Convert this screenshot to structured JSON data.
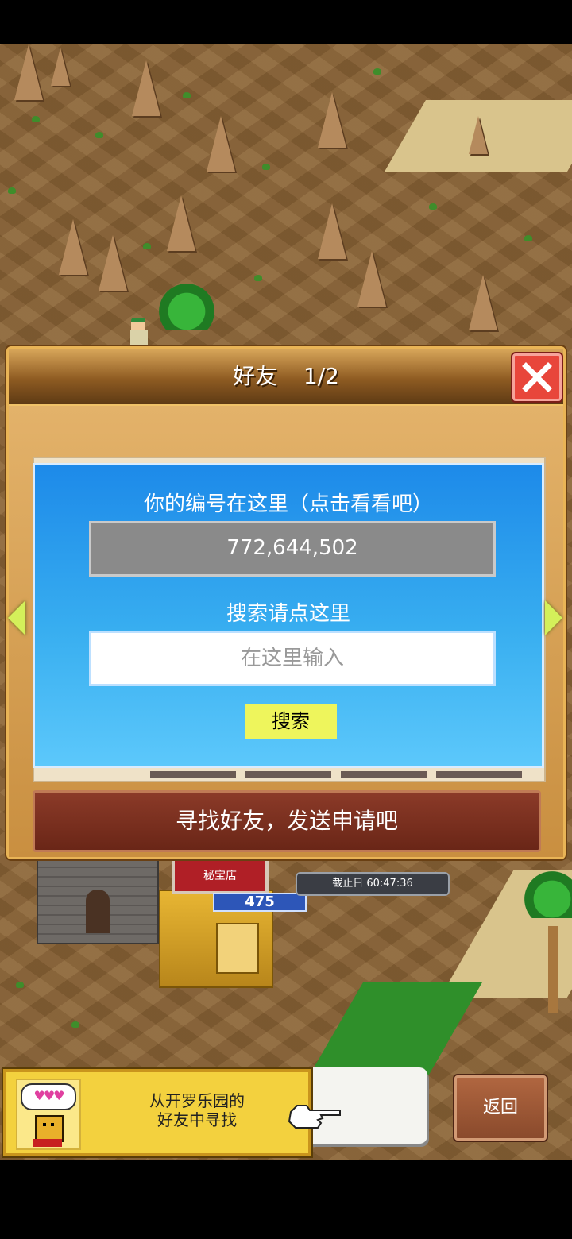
{
  "game": {
    "panel": {
      "title": "好友",
      "page": "1/2",
      "id_label": "你的编号在这里（点击看看吧）",
      "player_id": "772,644,502",
      "search_label": "搜索请点这里",
      "search_placeholder": "在这里输入",
      "search_button": "搜索",
      "find_button": "寻找好友，发送申请吧"
    },
    "map": {
      "shop_sign": "秘宝店",
      "shop_count": "475",
      "deadline": "截止日 60:47:36"
    },
    "bottom": {
      "friend_line1": "从开罗乐园的",
      "friend_line2": "好友中寻找",
      "hearts": "♥♥♥",
      "back_button": "返回"
    }
  },
  "colors": {
    "panel_brown": "#c48c3c",
    "blue_panel": "#1d8ae9",
    "close_red": "#e8463b",
    "search_yellow": "#eef55c"
  }
}
